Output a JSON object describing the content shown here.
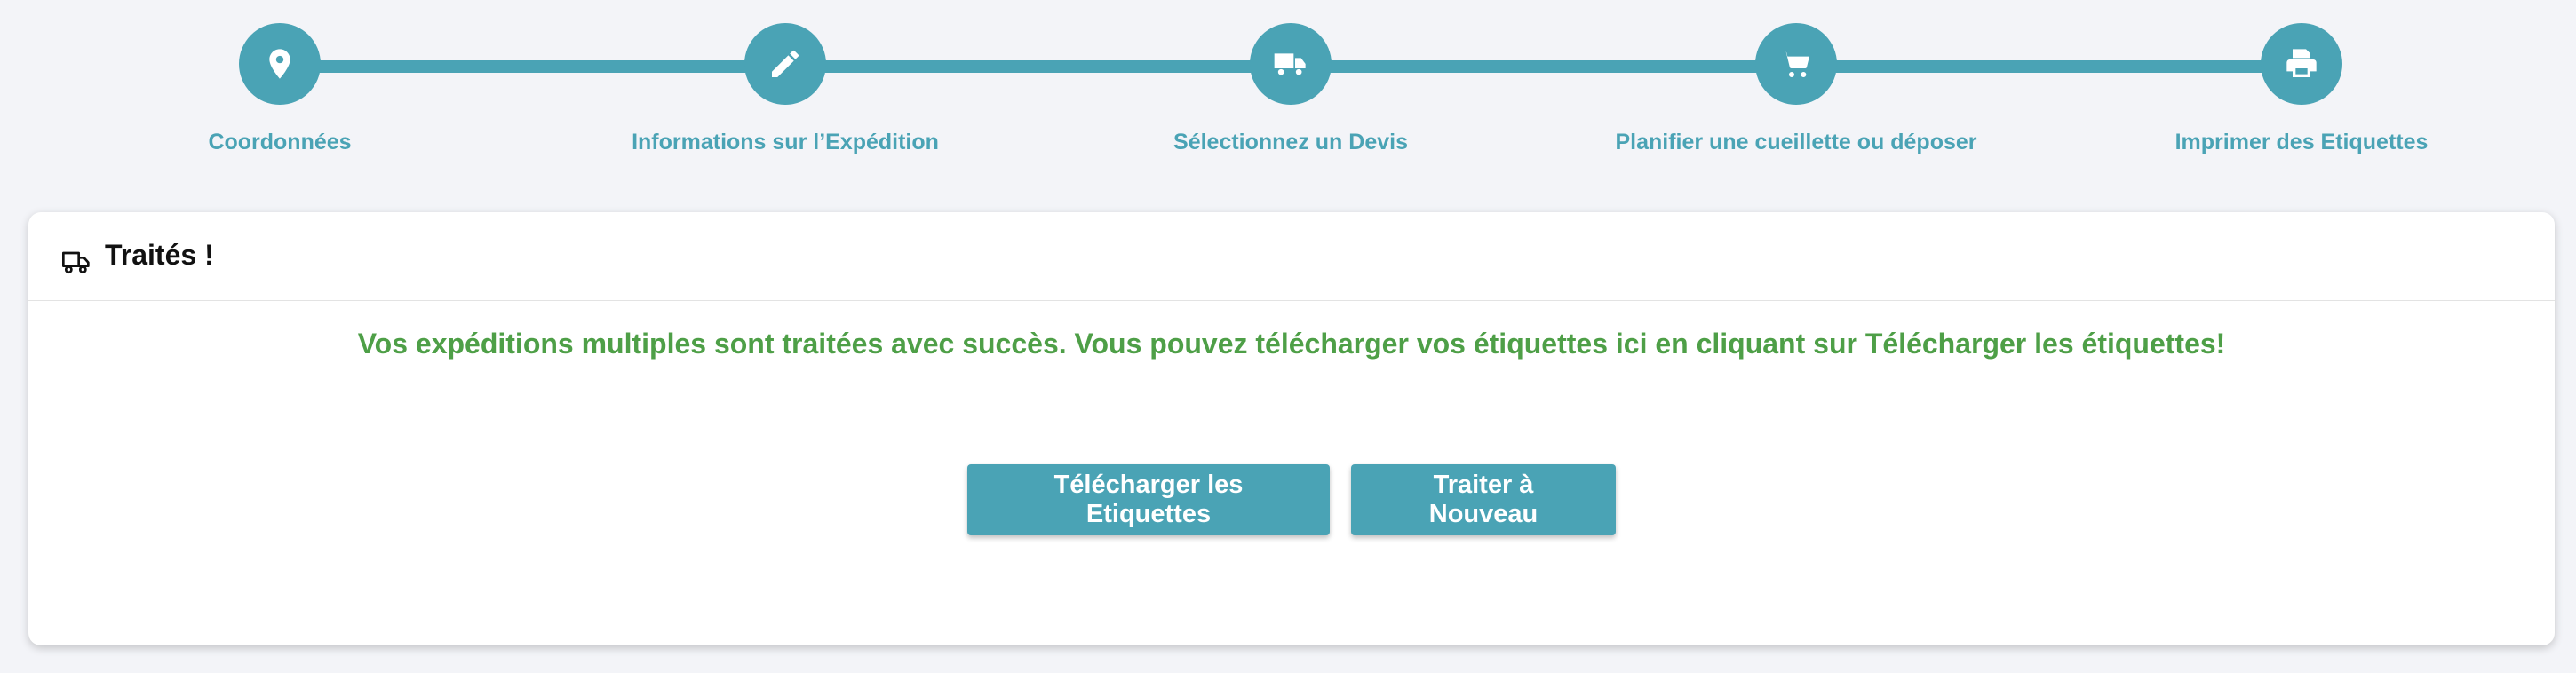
{
  "stepper": {
    "color": "#4aa3b5",
    "steps": [
      {
        "label": "Coordonnées",
        "icon": "map-marker-icon"
      },
      {
        "label": "Informations sur l’Expédition",
        "icon": "pencil-icon"
      },
      {
        "label": "Sélectionnez un Devis",
        "icon": "truck-icon"
      },
      {
        "label": "Planifier une cueillette ou déposer",
        "icon": "shopping-cart-icon"
      },
      {
        "label": "Imprimer des Etiquettes",
        "icon": "printer-icon"
      }
    ]
  },
  "card": {
    "icon": "truck-icon",
    "title": "Traités !",
    "message": "Vos expéditions multiples sont traitées avec succès. Vous pouvez télécharger vos étiquettes ici en cliquant sur Télécharger les étiquettes!",
    "message_color": "#4e9f47",
    "buttons": {
      "download_label": "Télécharger les Etiquettes",
      "reprocess_label": "Traiter à Nouveau"
    }
  }
}
